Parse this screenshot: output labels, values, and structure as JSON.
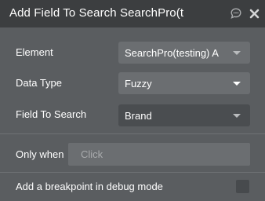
{
  "header": {
    "title": "Add Field To Search SearchPro(t"
  },
  "fields": {
    "element_label": "Element",
    "element_value": "SearchPro(testing) A",
    "data_type_label": "Data Type",
    "data_type_value": "Fuzzy",
    "field_to_search_label": "Field To Search",
    "field_to_search_value": "Brand"
  },
  "condition": {
    "only_when_label": "Only when",
    "only_when_placeholder": "Click"
  },
  "debug": {
    "breakpoint_label": "Add a breakpoint in debug mode",
    "breakpoint_checked": false
  },
  "icons": {
    "chat": "chat-bubble-icon",
    "close": "close-icon",
    "caret": "chevron-down-icon"
  },
  "colors": {
    "header_bg": "#3c3e40",
    "panel_bg": "#5a5d60",
    "field_bg": "#6b6e71",
    "text": "#ffffff"
  }
}
